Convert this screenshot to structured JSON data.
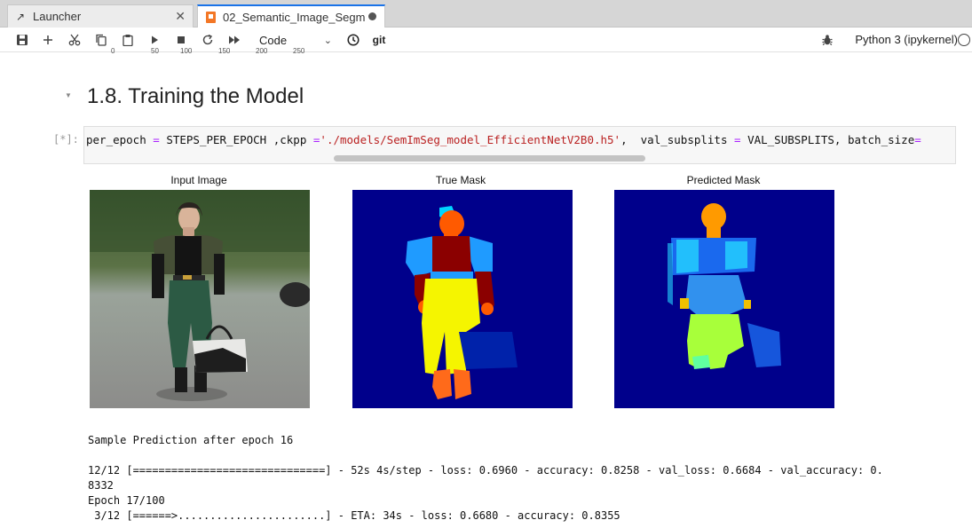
{
  "tabs": [
    {
      "label": "Launcher",
      "icon": "launcher-icon"
    },
    {
      "label": "02_Semantic_Image_Segm",
      "icon": "notebook-icon"
    }
  ],
  "toolbar": {
    "cell_type": "Code",
    "git_label": "git",
    "kernel_name": "Python 3 (ipykernel)"
  },
  "axis_ticks": [
    "0",
    "50",
    "100",
    "150",
    "200",
    "250"
  ],
  "section": {
    "heading": "1.8. Training the Model"
  },
  "cell": {
    "prompt": "[*]:",
    "code_plain_1": "per_epoch ",
    "code_op_1": "=",
    "code_plain_2": " STEPS_PER_EPOCH ,ckpp ",
    "code_op_2": "=",
    "code_str": "'./models/SemImSeg_model_EfficientNetV2B0.h5'",
    "code_plain_3": ",  val_subsplits ",
    "code_op_3": "=",
    "code_plain_4": " VAL_SUBSPLITS, batch_size",
    "code_op_4": "="
  },
  "figure": {
    "titles": [
      "Input Image",
      "True Mask",
      "Predicted Mask"
    ]
  },
  "output": {
    "line1": "Sample Prediction after epoch 16",
    "line2": "12/12 [==============================] - 52s 4s/step - loss: 0.6960 - accuracy: 0.8258 - val_loss: 0.6684 - val_accuracy: 0.",
    "line3": "8332",
    "line4": "Epoch 17/100",
    "line5": " 3/12 [======>.......................] - ETA: 34s - loss: 0.6680 - accuracy: 0.8355"
  },
  "colors": {
    "mask_background": "#00008b",
    "accent": "#1a73e8"
  }
}
